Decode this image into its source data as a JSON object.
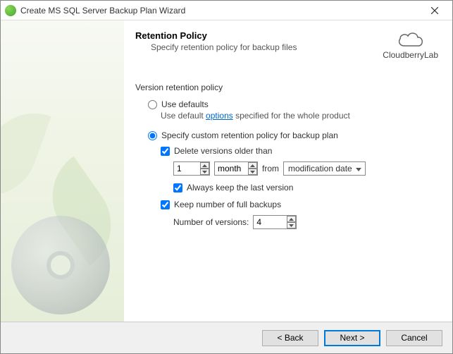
{
  "window": {
    "title": "Create MS SQL Server Backup Plan Wizard"
  },
  "brand": "CloudberryLab",
  "header": {
    "title": "Retention Policy",
    "subtitle": "Specify retention policy for backup files"
  },
  "section": {
    "groupLabel": "Version retention policy",
    "useDefaults": {
      "label": "Use defaults",
      "desc_pre": "Use default ",
      "desc_link": "options",
      "desc_post": " specified for the whole product",
      "checked": false
    },
    "custom": {
      "label": "Specify custom retention policy for backup plan",
      "checked": true,
      "deleteOlder": {
        "label": "Delete versions older than",
        "checked": true,
        "value": "1",
        "unit": "month",
        "fromLabel": "from",
        "fromValue": "modification date"
      },
      "alwaysKeepLast": {
        "label": "Always keep the last version",
        "checked": true
      },
      "keepNumber": {
        "label": "Keep number of full backups",
        "checked": true,
        "numLabel": "Number of versions:",
        "value": "4"
      }
    }
  },
  "buttons": {
    "back": "< Back",
    "next": "Next >",
    "cancel": "Cancel"
  }
}
